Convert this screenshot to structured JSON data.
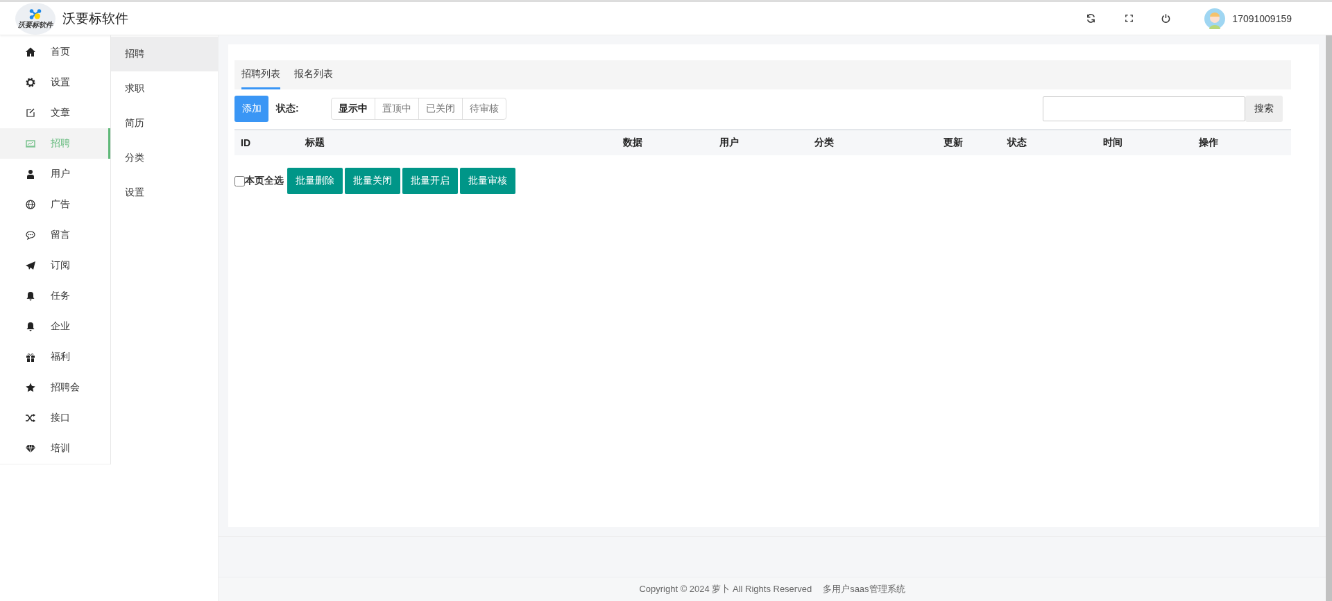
{
  "header": {
    "logo_text": "沃要标软件",
    "brand": "沃要标软件",
    "username": "17091009159"
  },
  "sidebar": {
    "items": [
      {
        "label": "首页",
        "selected": false
      },
      {
        "label": "设置",
        "selected": false
      },
      {
        "label": "文章",
        "selected": false
      },
      {
        "label": "招聘",
        "selected": true
      },
      {
        "label": "用户",
        "selected": false
      },
      {
        "label": "广告",
        "selected": false
      },
      {
        "label": "留言",
        "selected": false
      },
      {
        "label": "订阅",
        "selected": false
      },
      {
        "label": "任务",
        "selected": false
      },
      {
        "label": "企业",
        "selected": false
      },
      {
        "label": "福利",
        "selected": false
      },
      {
        "label": "招聘会",
        "selected": false
      },
      {
        "label": "接口",
        "selected": false
      },
      {
        "label": "培训",
        "selected": false
      }
    ]
  },
  "submenu": {
    "items": [
      {
        "label": "招聘",
        "selected": true
      },
      {
        "label": "求职",
        "selected": false
      },
      {
        "label": "简历",
        "selected": false
      },
      {
        "label": "分类",
        "selected": false
      },
      {
        "label": "设置",
        "selected": false
      }
    ]
  },
  "tabs": [
    {
      "label": "招聘列表",
      "selected": true
    },
    {
      "label": "报名列表",
      "selected": false
    }
  ],
  "toolbar": {
    "add_button": "添加",
    "status_label": "状态:",
    "status_filters": [
      {
        "label": "显示中",
        "selected": true
      },
      {
        "label": "置顶中",
        "selected": false
      },
      {
        "label": "已关闭",
        "selected": false
      },
      {
        "label": "待审核",
        "selected": false
      }
    ],
    "search_button": "搜索"
  },
  "table": {
    "columns": [
      "ID",
      "标题",
      "数据",
      "用户",
      "分类",
      "更新",
      "状态",
      "时间",
      "操作"
    ]
  },
  "bulk": {
    "select_all": {
      "label": "本页全选",
      "checked": false
    },
    "buttons": [
      "批量删除",
      "批量关闭",
      "批量开启",
      "批量审核"
    ]
  },
  "footer": {
    "copyright": "Copyright © 2024 萝卜 All Rights Reserved",
    "system": "多用户saas管理系统"
  }
}
